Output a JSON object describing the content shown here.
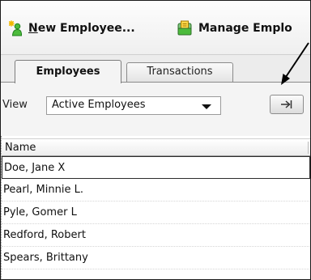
{
  "toolbar": {
    "new_employee": {
      "accel": "N",
      "rest": "ew Employee...",
      "icon": "new-employee-icon"
    },
    "manage_employee": {
      "label": "Manage Emplo",
      "icon": "manage-info-icon"
    }
  },
  "tabs": [
    {
      "label": "Employees",
      "active": true
    },
    {
      "label": "Transactions",
      "active": false
    }
  ],
  "filter": {
    "view_label": "View",
    "selected": "Active Employees"
  },
  "list": {
    "column_header": "Name",
    "rows": [
      {
        "name": "Doe, Jane X",
        "selected": true
      },
      {
        "name": "Pearl, Minnie L.",
        "selected": false
      },
      {
        "name": "Pyle, Gomer L",
        "selected": false
      },
      {
        "name": "Redford, Robert",
        "selected": false
      },
      {
        "name": "Spears, Brittany",
        "selected": false
      }
    ]
  },
  "colors": {
    "icon_yellow": "#f0b800",
    "icon_green": "#3aa935",
    "text": "#111111"
  }
}
